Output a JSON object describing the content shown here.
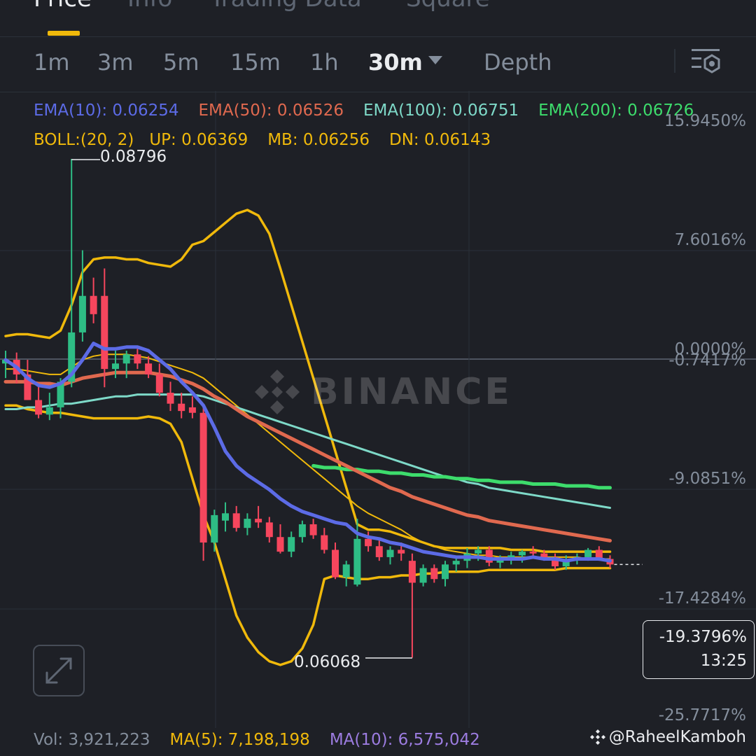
{
  "tabs": [
    "Price",
    "Info",
    "Trading Data",
    "Square"
  ],
  "intervals": [
    "1m",
    "3m",
    "5m",
    "15m",
    "1h",
    "30m",
    "Depth"
  ],
  "colors": {
    "up": "#2ebd85",
    "down": "#f6465d",
    "ema10": "#5c6be6",
    "ema50": "#e0694f",
    "ema100": "#7ed9c8",
    "ema200": "#3ddc6c",
    "boll": "#f0b90b"
  },
  "indicators": {
    "ema10": "EMA(10): 0.06254",
    "ema50": "EMA(50): 0.06526",
    "ema100": "EMA(100): 0.06751",
    "ema200": "EMA(200): 0.06726",
    "boll": "BOLL:(20, 2)",
    "up": "UP: 0.06369",
    "mb": "MB: 0.06256",
    "dn": "DN: 0.06143"
  },
  "price_axis": [
    "15.9450%",
    "7.6016%",
    "0.0000%",
    "-0.7417%",
    "-9.0851%",
    "-17.4284%",
    "-25.7717%"
  ],
  "high_label": "0.08796",
  "low_label": "0.06068",
  "current": {
    "pct": "-19.3796%",
    "countdown": "13:25"
  },
  "watermark": "BINANCE",
  "volume": {
    "vol": "Vol: 3,921,223",
    "ma5": "MA(5): 7,198,198",
    "ma10": "MA(10): 6,575,042"
  },
  "credit": "@RaheelKamboh",
  "chart_data": {
    "type": "candlestick",
    "interval": "30m",
    "y_axis_percent_range": [
      -25.7717,
      15.945
    ],
    "high": 0.08796,
    "low": 0.06068,
    "candles": [
      [
        0.0768,
        0.0775,
        0.076,
        0.077
      ],
      [
        0.077,
        0.0774,
        0.0757,
        0.0762
      ],
      [
        0.0762,
        0.077,
        0.0748,
        0.0748
      ],
      [
        0.0748,
        0.0756,
        0.0738,
        0.074
      ],
      [
        0.074,
        0.0752,
        0.0737,
        0.0744
      ],
      [
        0.0744,
        0.076,
        0.0738,
        0.0758
      ],
      [
        0.0758,
        0.088,
        0.0755,
        0.0785
      ],
      [
        0.0785,
        0.083,
        0.078,
        0.0805
      ],
      [
        0.0805,
        0.0815,
        0.079,
        0.0795
      ],
      [
        0.0805,
        0.082,
        0.0755,
        0.0765
      ],
      [
        0.0765,
        0.0775,
        0.076,
        0.0768
      ],
      [
        0.0768,
        0.0775,
        0.076,
        0.0773
      ],
      [
        0.0773,
        0.0776,
        0.0765,
        0.0768
      ],
      [
        0.0768,
        0.0772,
        0.076,
        0.0762
      ],
      [
        0.0762,
        0.0768,
        0.075,
        0.0752
      ],
      [
        0.0752,
        0.0758,
        0.0742,
        0.0746
      ],
      [
        0.0746,
        0.0752,
        0.0738,
        0.0742
      ],
      [
        0.0744,
        0.075,
        0.0738,
        0.0741
      ],
      [
        0.0741,
        0.0745,
        0.066,
        0.067
      ],
      [
        0.067,
        0.0688,
        0.0665,
        0.0685
      ],
      [
        0.0682,
        0.0692,
        0.0676,
        0.0686
      ],
      [
        0.0686,
        0.069,
        0.0676,
        0.0678
      ],
      [
        0.0678,
        0.0686,
        0.0674,
        0.0683
      ],
      [
        0.0683,
        0.069,
        0.0678,
        0.0681
      ],
      [
        0.0681,
        0.0684,
        0.067,
        0.0673
      ],
      [
        0.0673,
        0.068,
        0.0664,
        0.0665
      ],
      [
        0.0665,
        0.0676,
        0.0662,
        0.0673
      ],
      [
        0.0673,
        0.0682,
        0.067,
        0.068
      ],
      [
        0.068,
        0.0683,
        0.0672,
        0.0674
      ],
      [
        0.0674,
        0.0678,
        0.0664,
        0.0666
      ],
      [
        0.0666,
        0.067,
        0.065,
        0.0651
      ],
      [
        0.0651,
        0.066,
        0.0646,
        0.0658
      ],
      [
        0.0647,
        0.0683,
        0.0646,
        0.0672
      ],
      [
        0.0672,
        0.0676,
        0.0665,
        0.0668
      ],
      [
        0.0668,
        0.0672,
        0.066,
        0.0662
      ],
      [
        0.0662,
        0.0668,
        0.0658,
        0.0666
      ],
      [
        0.0666,
        0.067,
        0.066,
        0.0664
      ],
      [
        0.066,
        0.0664,
        0.0607,
        0.0648
      ],
      [
        0.0648,
        0.0658,
        0.0646,
        0.0656
      ],
      [
        0.0656,
        0.0658,
        0.0648,
        0.065
      ],
      [
        0.065,
        0.066,
        0.0646,
        0.0658
      ],
      [
        0.0658,
        0.0662,
        0.0654,
        0.066
      ],
      [
        0.066,
        0.0667,
        0.0656,
        0.0664
      ],
      [
        0.0664,
        0.0668,
        0.066,
        0.0666
      ],
      [
        0.0666,
        0.0668,
        0.0657,
        0.0659
      ],
      [
        0.0659,
        0.0663,
        0.0656,
        0.0661
      ],
      [
        0.0661,
        0.0665,
        0.0658,
        0.0663
      ],
      [
        0.0663,
        0.0666,
        0.0659,
        0.0665
      ],
      [
        0.0665,
        0.0668,
        0.0661,
        0.0664
      ],
      [
        0.0664,
        0.0666,
        0.066,
        0.0662
      ],
      [
        0.0662,
        0.0664,
        0.0655,
        0.0657
      ],
      [
        0.0657,
        0.0663,
        0.0655,
        0.0661
      ],
      [
        0.0661,
        0.0664,
        0.0658,
        0.0662
      ],
      [
        0.0662,
        0.0667,
        0.066,
        0.0666
      ],
      [
        0.0666,
        0.0668,
        0.066,
        0.0661
      ],
      [
        0.0661,
        0.0663,
        0.0656,
        0.0658
      ]
    ],
    "series": [
      {
        "name": "EMA(10)",
        "values": [
          0.077,
          0.0766,
          0.076,
          0.0756,
          0.0755,
          0.0757,
          0.0762,
          0.077,
          0.0779,
          0.0776,
          0.0776,
          0.0777,
          0.0777,
          0.0775,
          0.077,
          0.0765,
          0.0758,
          0.0752,
          0.0745,
          0.0733,
          0.072,
          0.0712,
          0.0707,
          0.0703,
          0.0699,
          0.0694,
          0.069,
          0.0687,
          0.0685,
          0.0683,
          0.0681,
          0.068,
          0.0675,
          0.0673,
          0.0672,
          0.067,
          0.0669,
          0.0667,
          0.0665,
          0.0664,
          0.0663,
          0.0662,
          0.0662,
          0.0662,
          0.0661,
          0.0661,
          0.0661,
          0.0661,
          0.0662,
          0.0661,
          0.0661,
          0.066,
          0.0661,
          0.0661,
          0.0661,
          0.066
        ]
      },
      {
        "name": "EMA(50)",
        "values": [
          0.0758,
          0.0758,
          0.0758,
          0.0757,
          0.0757,
          0.0756,
          0.0758,
          0.076,
          0.0761,
          0.0762,
          0.0763,
          0.0763,
          0.0763,
          0.0763,
          0.0762,
          0.0761,
          0.0759,
          0.0757,
          0.0754,
          0.075,
          0.0747,
          0.0743,
          0.0739,
          0.0736,
          0.0733,
          0.073,
          0.0727,
          0.0724,
          0.0721,
          0.0718,
          0.0715,
          0.0712,
          0.0709,
          0.0706,
          0.0703,
          0.07,
          0.0698,
          0.0695,
          0.0693,
          0.0691,
          0.0689,
          0.0687,
          0.0685,
          0.0684,
          0.0682,
          0.0681,
          0.068,
          0.0679,
          0.0678,
          0.0677,
          0.0676,
          0.0675,
          0.0674,
          0.0673,
          0.0672,
          0.0671
        ]
      },
      {
        "name": "EMA(100)",
        "values": [
          0.0743,
          0.0743,
          0.0744,
          0.0744,
          0.0745,
          0.0746,
          0.0746,
          0.0747,
          0.0748,
          0.0749,
          0.075,
          0.075,
          0.0751,
          0.0751,
          0.0751,
          0.0751,
          0.0751,
          0.0751,
          0.075,
          0.0748,
          0.0746,
          0.0744,
          0.0742,
          0.074,
          0.0738,
          0.0736,
          0.0734,
          0.0732,
          0.073,
          0.0728,
          0.0726,
          0.0724,
          0.0722,
          0.072,
          0.0718,
          0.0716,
          0.0714,
          0.0712,
          0.071,
          0.0708,
          0.0706,
          0.0705,
          0.0703,
          0.0702,
          0.07,
          0.0699,
          0.0698,
          0.0697,
          0.0696,
          0.0695,
          0.0694,
          0.0693,
          0.0692,
          0.0691,
          0.069,
          0.0689
        ]
      },
      {
        "name": "EMA(200)",
        "values": [
          null,
          null,
          null,
          null,
          null,
          null,
          null,
          null,
          null,
          null,
          null,
          null,
          null,
          null,
          null,
          null,
          null,
          null,
          null,
          null,
          null,
          null,
          null,
          null,
          null,
          null,
          null,
          null,
          0.0712,
          0.0711,
          0.0711,
          0.071,
          0.071,
          0.0709,
          0.0709,
          0.0708,
          0.0708,
          0.0707,
          0.0707,
          0.0706,
          0.0706,
          0.0705,
          0.0705,
          0.0704,
          0.0704,
          0.0703,
          0.0703,
          0.0703,
          0.0702,
          0.0702,
          0.0702,
          0.0701,
          0.0701,
          0.0701,
          0.07,
          0.07
        ]
      },
      {
        "name": "BOLL UP",
        "values": [
          0.0783,
          0.0784,
          0.0784,
          0.0783,
          0.0782,
          0.0786,
          0.08,
          0.0818,
          0.0825,
          0.0826,
          0.0826,
          0.0825,
          0.0825,
          0.0823,
          0.0822,
          0.0821,
          0.0825,
          0.0833,
          0.0835,
          0.084,
          0.0845,
          0.085,
          0.0852,
          0.0849,
          0.0839,
          0.082,
          0.08,
          0.078,
          0.076,
          0.074,
          0.072,
          0.07,
          0.068,
          0.0677,
          0.0677,
          0.0676,
          0.0674,
          0.0672,
          0.067,
          0.0668,
          0.0667,
          0.0667,
          0.0667,
          0.0667,
          0.0667,
          0.0667,
          0.0666,
          0.0666,
          0.0666,
          0.0665,
          0.0665,
          0.0665,
          0.0665,
          0.0665,
          0.0665,
          0.0665
        ]
      },
      {
        "name": "BOLL MB",
        "values": [
          0.0765,
          0.0765,
          0.0764,
          0.0763,
          0.0762,
          0.0762,
          0.0766,
          0.077,
          0.0772,
          0.0773,
          0.0773,
          0.0773,
          0.0772,
          0.0771,
          0.0769,
          0.0767,
          0.0765,
          0.0763,
          0.076,
          0.0755,
          0.075,
          0.0745,
          0.074,
          0.0735,
          0.073,
          0.0725,
          0.072,
          0.0715,
          0.071,
          0.0705,
          0.07,
          0.0695,
          0.069,
          0.0686,
          0.0683,
          0.068,
          0.0677,
          0.0673,
          0.067,
          0.0668,
          0.0666,
          0.0665,
          0.0664,
          0.0663,
          0.0663,
          0.0662,
          0.0662,
          0.0662,
          0.0662,
          0.0662,
          0.0662,
          0.0662,
          0.0662,
          0.0661,
          0.0661,
          0.0661
        ]
      },
      {
        "name": "BOLL DN",
        "values": [
          0.0745,
          0.0745,
          0.0743,
          0.0742,
          0.0741,
          0.0741,
          0.074,
          0.0739,
          0.0738,
          0.0738,
          0.0738,
          0.0738,
          0.0738,
          0.0739,
          0.0738,
          0.0735,
          0.0725,
          0.0705,
          0.0685,
          0.067,
          0.065,
          0.063,
          0.0618,
          0.061,
          0.0605,
          0.0603,
          0.0605,
          0.0612,
          0.0625,
          0.065,
          0.0652,
          0.0651,
          0.065,
          0.065,
          0.0651,
          0.0651,
          0.0652,
          0.0652,
          0.0653,
          0.0653,
          0.0654,
          0.0654,
          0.0654,
          0.0654,
          0.0655,
          0.0655,
          0.0655,
          0.0655,
          0.0655,
          0.0655,
          0.0655,
          0.0656,
          0.0656,
          0.0656,
          0.0656,
          0.0656
        ]
      }
    ]
  }
}
